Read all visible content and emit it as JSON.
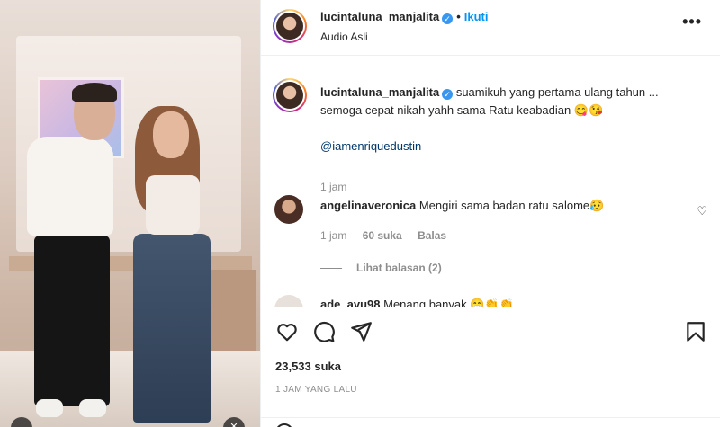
{
  "post": {
    "username": "lucintaluna_manjalita",
    "follow_label": "Ikuti",
    "audio_label": "Audio Asli",
    "more_label": "•••"
  },
  "caption": {
    "username": "lucintaluna_manjalita",
    "line1": "suamikuh yang pertama ulang tahun ...",
    "line2": "semoga cepat nikah yahh sama Ratu keabadian 😋😘",
    "mention": "@iamenriquedustin",
    "time": "1 jam"
  },
  "comments": [
    {
      "username": "angelinaveronica",
      "text": "Mengiri sama badan ratu salome😥",
      "time": "1 jam",
      "likes": "60 suka",
      "reply_label": "Balas",
      "view_replies": "Lihat balasan (2)"
    },
    {
      "username": "ade_ayu98",
      "text": "Menang banyak 😁👏👏"
    }
  ],
  "footer": {
    "likes": "23,533 suka",
    "timestamp": "1 JAM YANG LALU"
  },
  "colors": {
    "accent": "#0095f6",
    "verified": "#3897f0",
    "text": "#262626",
    "muted": "#8e8e8e"
  },
  "icons": [
    "heart-icon",
    "comment-icon",
    "share-icon",
    "bookmark-icon",
    "more-icon",
    "verified-icon",
    "emoji-icon",
    "mute-icon"
  ]
}
